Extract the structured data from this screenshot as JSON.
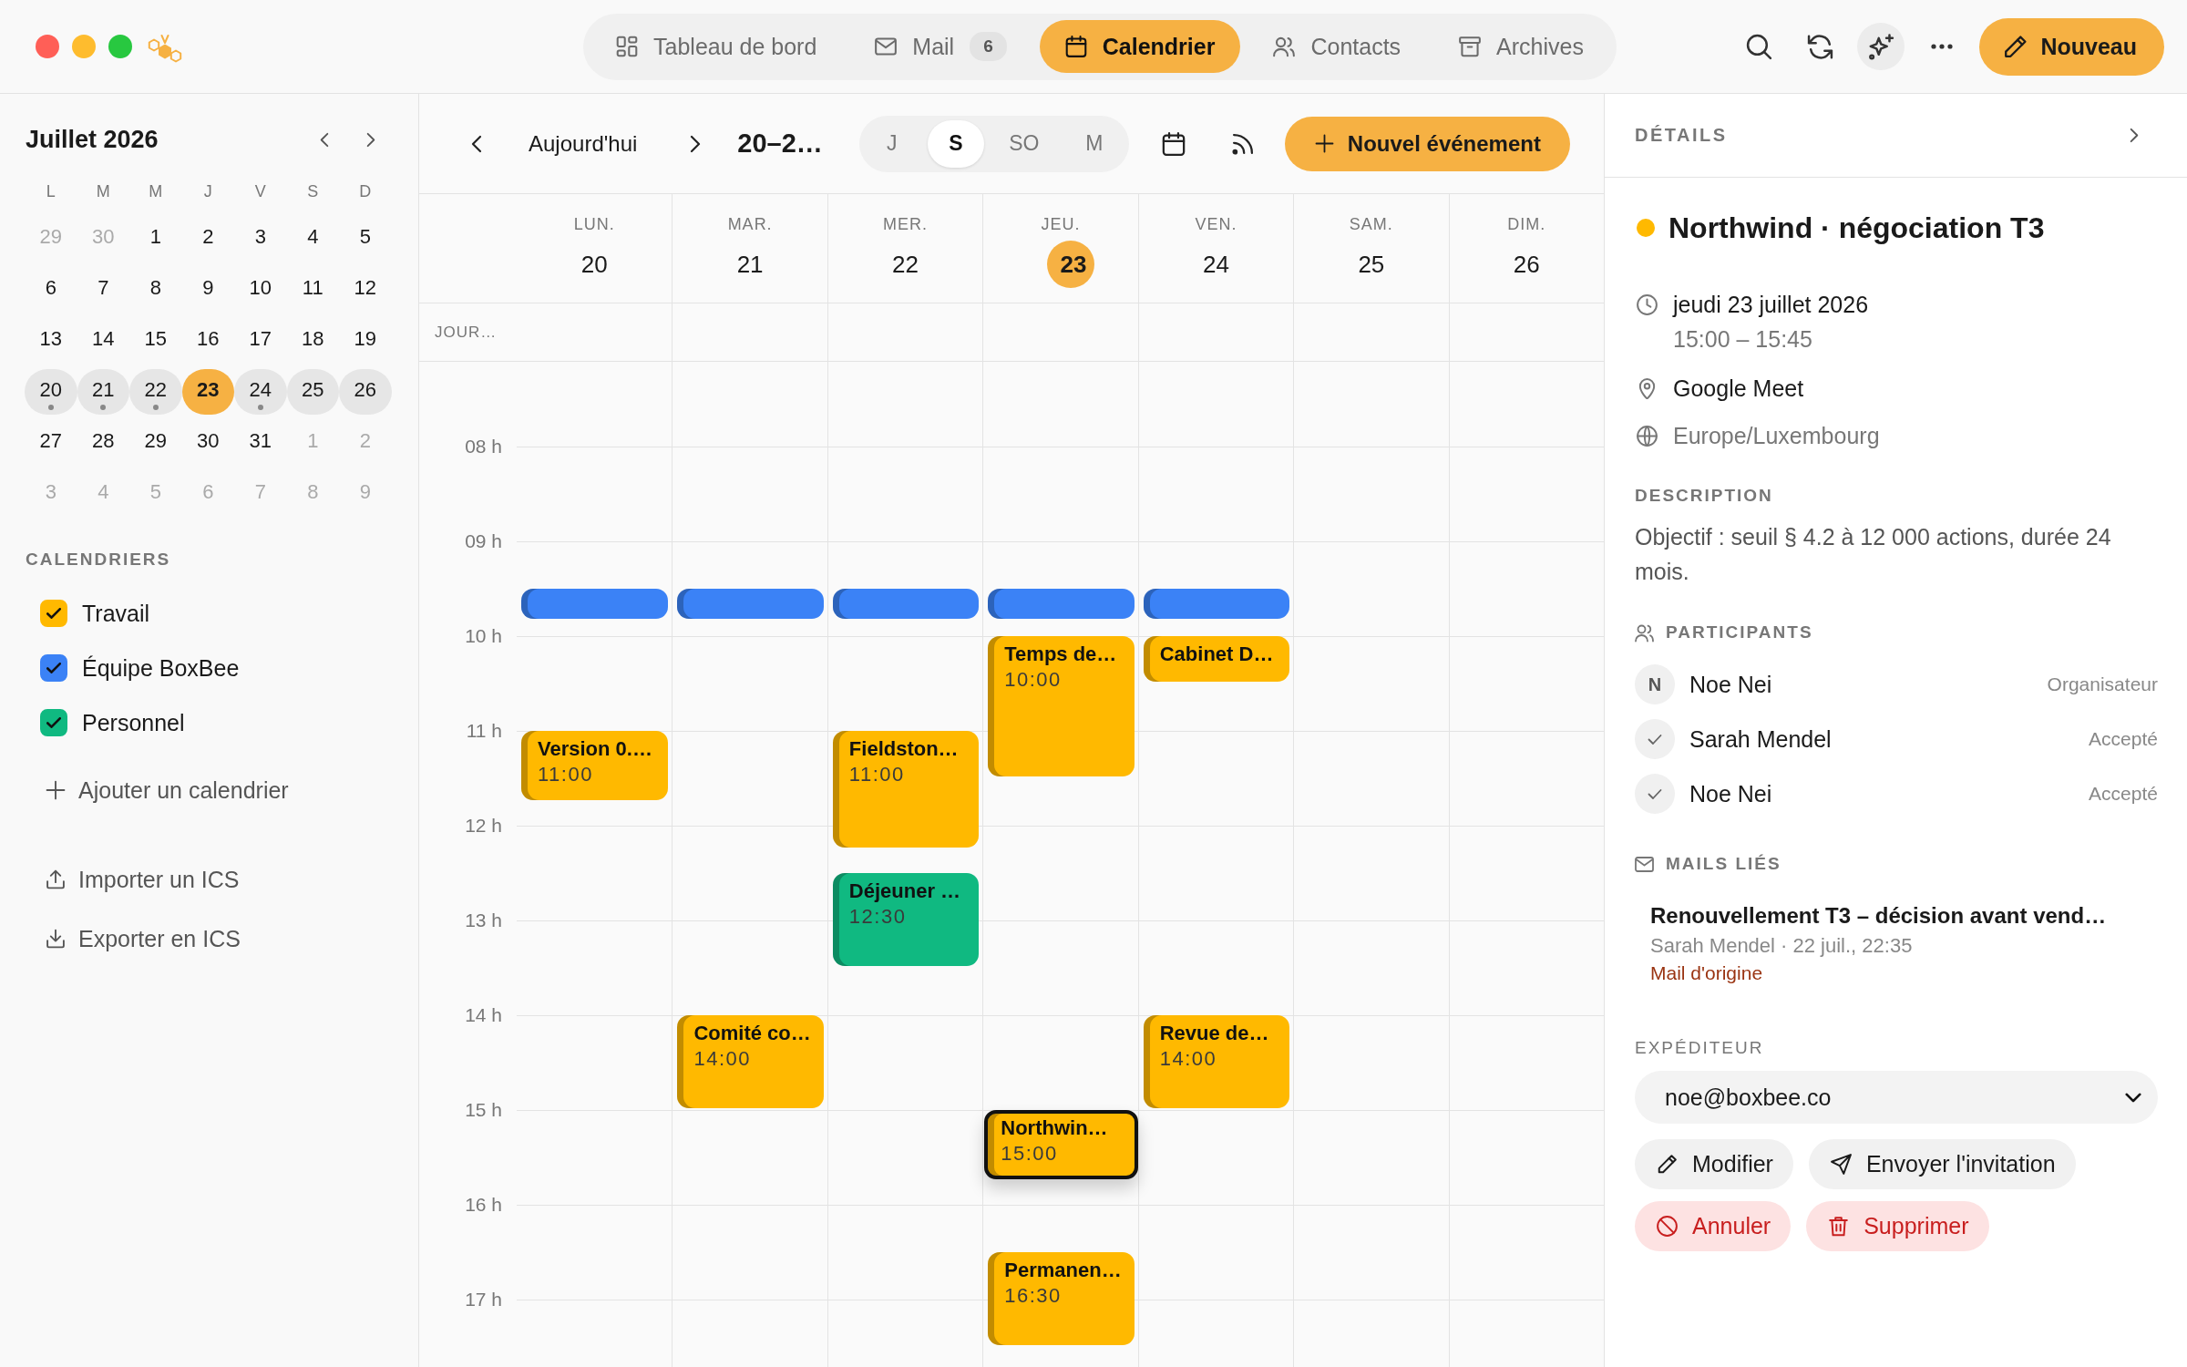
{
  "top_bar": {
    "tabs": [
      {
        "label": "Tableau de bord",
        "selected": false
      },
      {
        "label": "Mail",
        "badge": "6",
        "selected": false
      },
      {
        "label": "Calendrier",
        "selected": true
      },
      {
        "label": "Contacts",
        "selected": false
      },
      {
        "label": "Archives",
        "selected": false
      }
    ],
    "tool_buttons": [
      {
        "active": false
      },
      {
        "active": false
      },
      {
        "active": true
      },
      {
        "active": false
      }
    ],
    "new_button": "Nouveau"
  },
  "sidebar": {
    "month_title": "Juillet 2026",
    "weekdays": [
      "L",
      "M",
      "M",
      "J",
      "V",
      "S",
      "D"
    ],
    "weeks": [
      [
        {
          "day": "29",
          "outside": true,
          "in_week": false,
          "selected": false,
          "has_events": false
        },
        {
          "day": "30",
          "outside": true,
          "in_week": false,
          "selected": false,
          "has_events": false
        },
        {
          "day": "1",
          "outside": false,
          "in_week": false,
          "selected": false,
          "has_events": false
        },
        {
          "day": "2",
          "outside": false,
          "in_week": false,
          "selected": false,
          "has_events": false
        },
        {
          "day": "3",
          "outside": false,
          "in_week": false,
          "selected": false,
          "has_events": false
        },
        {
          "day": "4",
          "outside": false,
          "in_week": false,
          "selected": false,
          "has_events": false
        },
        {
          "day": "5",
          "outside": false,
          "in_week": false,
          "selected": false,
          "has_events": false
        }
      ],
      [
        {
          "day": "6",
          "outside": false,
          "in_week": false,
          "selected": false,
          "has_events": false
        },
        {
          "day": "7",
          "outside": false,
          "in_week": false,
          "selected": false,
          "has_events": false
        },
        {
          "day": "8",
          "outside": false,
          "in_week": false,
          "selected": false,
          "has_events": false
        },
        {
          "day": "9",
          "outside": false,
          "in_week": false,
          "selected": false,
          "has_events": false
        },
        {
          "day": "10",
          "outside": false,
          "in_week": false,
          "selected": false,
          "has_events": false
        },
        {
          "day": "11",
          "outside": false,
          "in_week": false,
          "selected": false,
          "has_events": false
        },
        {
          "day": "12",
          "outside": false,
          "in_week": false,
          "selected": false,
          "has_events": false
        }
      ],
      [
        {
          "day": "13",
          "outside": false,
          "in_week": false,
          "selected": false,
          "has_events": false
        },
        {
          "day": "14",
          "outside": false,
          "in_week": false,
          "selected": false,
          "has_events": false
        },
        {
          "day": "15",
          "outside": false,
          "in_week": false,
          "selected": false,
          "has_events": false
        },
        {
          "day": "16",
          "outside": false,
          "in_week": false,
          "selected": false,
          "has_events": false
        },
        {
          "day": "17",
          "outside": false,
          "in_week": false,
          "selected": false,
          "has_events": false
        },
        {
          "day": "18",
          "outside": false,
          "in_week": false,
          "selected": false,
          "has_events": false
        },
        {
          "day": "19",
          "outside": false,
          "in_week": false,
          "selected": false,
          "has_events": false
        }
      ],
      [
        {
          "day": "20",
          "outside": false,
          "in_week": true,
          "selected": false,
          "has_events": true
        },
        {
          "day": "21",
          "outside": false,
          "in_week": true,
          "selected": false,
          "has_events": true
        },
        {
          "day": "22",
          "outside": false,
          "in_week": true,
          "selected": false,
          "has_events": true
        },
        {
          "day": "23",
          "outside": false,
          "in_week": true,
          "selected": true,
          "has_events": false
        },
        {
          "day": "24",
          "outside": false,
          "in_week": true,
          "selected": false,
          "has_events": true
        },
        {
          "day": "25",
          "outside": false,
          "in_week": true,
          "selected": false,
          "has_events": false
        },
        {
          "day": "26",
          "outside": false,
          "in_week": true,
          "selected": false,
          "has_events": false
        }
      ],
      [
        {
          "day": "27",
          "outside": false,
          "in_week": false,
          "selected": false,
          "has_events": false
        },
        {
          "day": "28",
          "outside": false,
          "in_week": false,
          "selected": false,
          "has_events": false
        },
        {
          "day": "29",
          "outside": false,
          "in_week": false,
          "selected": false,
          "has_events": false
        },
        {
          "day": "30",
          "outside": false,
          "in_week": false,
          "selected": false,
          "has_events": false
        },
        {
          "day": "31",
          "outside": false,
          "in_week": false,
          "selected": false,
          "has_events": false
        },
        {
          "day": "1",
          "outside": true,
          "in_week": false,
          "selected": false,
          "has_events": false
        },
        {
          "day": "2",
          "outside": true,
          "in_week": false,
          "selected": false,
          "has_events": false
        }
      ],
      [
        {
          "day": "3",
          "outside": true,
          "in_week": false,
          "selected": false,
          "has_events": false
        },
        {
          "day": "4",
          "outside": true,
          "in_week": false,
          "selected": false,
          "has_events": false
        },
        {
          "day": "5",
          "outside": true,
          "in_week": false,
          "selected": false,
          "has_events": false
        },
        {
          "day": "6",
          "outside": true,
          "in_week": false,
          "selected": false,
          "has_events": false
        },
        {
          "day": "7",
          "outside": true,
          "in_week": false,
          "selected": false,
          "has_events": false
        },
        {
          "day": "8",
          "outside": true,
          "in_week": false,
          "selected": false,
          "has_events": false
        },
        {
          "day": "9",
          "outside": true,
          "in_week": false,
          "selected": false,
          "has_events": false
        }
      ]
    ],
    "calendars_heading": "CALENDRIERS",
    "calendars": [
      {
        "label": "Travail",
        "color": "#ffb900",
        "checked": true
      },
      {
        "label": "Équipe BoxBee",
        "color": "#3b82f6",
        "checked": true
      },
      {
        "label": "Personnel",
        "color": "#10b981",
        "checked": true
      }
    ],
    "add_calendar": "Ajouter un calendrier",
    "import": "Importer un ICS",
    "export": "Exporter en ICS"
  },
  "calendar": {
    "toolbar": {
      "today": "Aujourd'hui",
      "range": "20–2…",
      "views": [
        {
          "label": "J",
          "selected": false
        },
        {
          "label": "S",
          "selected": true
        },
        {
          "label": "SO",
          "selected": false
        },
        {
          "label": "M",
          "selected": false
        }
      ],
      "new_event": "Nouvel événement"
    },
    "all_day_label": "JOUR…",
    "hours": [
      "08 h",
      "09 h",
      "10 h",
      "11 h",
      "12 h",
      "13 h",
      "14 h",
      "15 h",
      "16 h",
      "17 h"
    ],
    "days": [
      {
        "weekday": "LUN.",
        "date": "20",
        "today": false,
        "events": [
          {
            "color": "#3b82f6",
            "selected": false
          },
          {
            "title": "Version 0.…",
            "time": "11:00",
            "color": "#ffb900",
            "selected": false
          }
        ]
      },
      {
        "weekday": "MAR.",
        "date": "21",
        "today": false,
        "events": [
          {
            "color": "#3b82f6",
            "selected": false
          },
          {
            "title": "Comité co…",
            "time": "14:00",
            "color": "#ffb900",
            "selected": false
          }
        ]
      },
      {
        "weekday": "MER.",
        "date": "22",
        "today": false,
        "events": [
          {
            "color": "#3b82f6",
            "selected": false
          },
          {
            "title": "Fieldston…",
            "time": "11:00",
            "color": "#ffb900",
            "selected": false
          },
          {
            "title": "Déjeuner …",
            "time": "12:30",
            "color": "#10b981",
            "selected": false
          }
        ]
      },
      {
        "weekday": "JEU.",
        "date": "23",
        "today": true,
        "events": [
          {
            "color": "#3b82f6",
            "selected": false
          },
          {
            "title": "Temps de…",
            "time": "10:00",
            "color": "#ffb900",
            "selected": false
          },
          {
            "title": "Northwin…",
            "time": "15:00",
            "color": "#ffb900",
            "selected": true
          },
          {
            "title": "Permanen…",
            "time": "16:30",
            "color": "#ffb900",
            "selected": false
          }
        ]
      },
      {
        "weekday": "VEN.",
        "date": "24",
        "today": false,
        "events": [
          {
            "color": "#3b82f6",
            "selected": false
          },
          {
            "title": "Cabinet D…",
            "color": "#ffb900",
            "selected": false
          },
          {
            "title": "Revue de…",
            "time": "14:00",
            "color": "#ffb900",
            "selected": false
          }
        ]
      },
      {
        "weekday": "SAM.",
        "date": "25",
        "today": false
      },
      {
        "weekday": "DIM.",
        "date": "26",
        "today": false
      }
    ]
  },
  "details": {
    "heading": "DÉTAILS",
    "title": "Northwind · négociation T3",
    "date": "jeudi 23 juillet 2026",
    "time": "15:00 – 15:45",
    "location": "Google Meet",
    "timezone": "Europe/Luxembourg",
    "description_heading": "DESCRIPTION",
    "description": "Objectif : seuil § 4.2 à 12 000 actions, durée 24 mois.",
    "participants_heading": "PARTICIPANTS",
    "participants": [
      {
        "kind": "organizer",
        "initial": "N",
        "name": "Noe Nei",
        "role": "Organisateur"
      },
      {
        "kind": "accepted",
        "name": "Sarah Mendel",
        "role": "Accepté"
      },
      {
        "kind": "accepted",
        "name": "Noe Nei",
        "role": "Accepté"
      }
    ],
    "mails_heading": "MAILS LIÉS",
    "mails": [
      {
        "subject": "Renouvellement T3 – décision avant vend…",
        "meta": "Sarah Mendel · 22 juil., 22:35",
        "link": "Mail d'origine"
      }
    ],
    "sender_heading": "EXPÉDITEUR",
    "sender": "noe@boxbee.co",
    "actions": [
      {
        "kind": "neutral",
        "label": "Modifier"
      },
      {
        "kind": "neutral",
        "label": "Envoyer l'invitation"
      },
      {
        "kind": "danger",
        "label": "Annuler"
      },
      {
        "kind": "danger",
        "label": "Supprimer"
      }
    ]
  }
}
